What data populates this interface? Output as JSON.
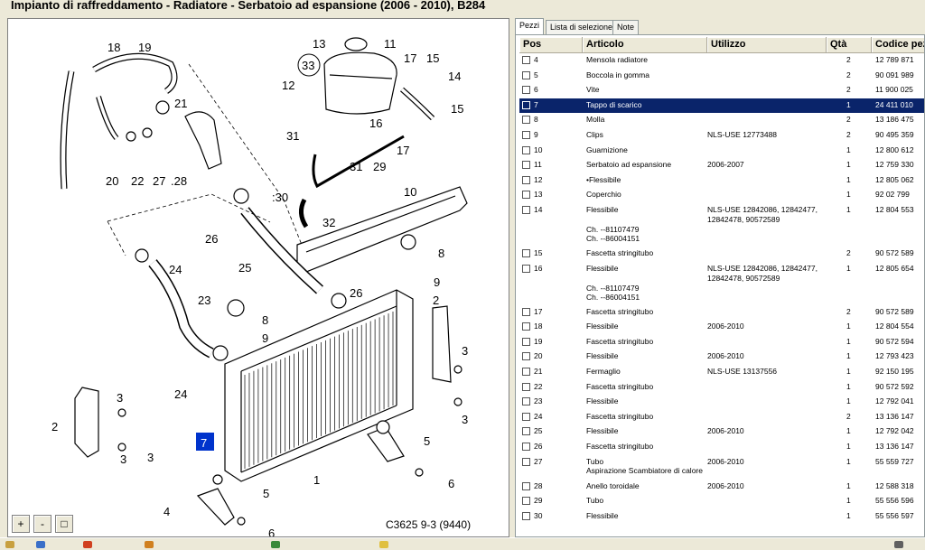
{
  "window": {
    "title": "Impianto di raffreddamento - Radiatore - Serbatoio ad espansione   (2006 - 2010), B284"
  },
  "diagram": {
    "figure_ref": "C3625 9-3 (9440)",
    "selected_callout": "7",
    "callouts": [
      "18",
      "19",
      "13",
      "11",
      "17",
      "15",
      "14",
      "15",
      "33",
      "12",
      "21",
      "16",
      "17",
      "31",
      "20",
      "22",
      "27",
      ".28",
      "31",
      "29",
      ":30",
      "10",
      "32",
      "26",
      "24",
      "25",
      "26",
      "8",
      "9",
      "23",
      "8",
      "9",
      "2",
      "3",
      "24",
      "3",
      "2",
      "3",
      "3",
      "5",
      "7",
      "5",
      "1",
      "4",
      "6",
      "6"
    ],
    "zoom": {
      "zoom_in": "+",
      "zoom_out": "-",
      "fit": "□"
    }
  },
  "tabs": [
    {
      "label": "Pezzi",
      "active": true
    },
    {
      "label": "Lista di selezione",
      "active": false
    },
    {
      "label": "Note",
      "active": false
    }
  ],
  "table": {
    "columns": [
      "Pos",
      "Articolo",
      "Utilizzo",
      "Qtà",
      "Codice pezzo"
    ],
    "selected_pos": "7",
    "rows": [
      {
        "pos": "4",
        "articolo": "Mensola radiatore",
        "utilizzo": "",
        "qta": "2",
        "codice": "12 789 871"
      },
      {
        "pos": "5",
        "articolo": "Boccola in gomma",
        "utilizzo": "",
        "qta": "2",
        "codice": "90 091 989"
      },
      {
        "pos": "6",
        "articolo": "Vite",
        "utilizzo": "",
        "qta": "2",
        "codice": "11 900 025"
      },
      {
        "pos": "7",
        "articolo": "Tappo di scarico",
        "utilizzo": "",
        "qta": "1",
        "codice": "24 411 010"
      },
      {
        "pos": "8",
        "articolo": "Molla",
        "utilizzo": "",
        "qta": "2",
        "codice": "13 186 475"
      },
      {
        "pos": "9",
        "articolo": "Clips",
        "utilizzo": "NLS-USE 12773488",
        "qta": "2",
        "codice": "90 495 359"
      },
      {
        "pos": "10",
        "articolo": "Guarnizione",
        "utilizzo": "",
        "qta": "1",
        "codice": "12 800 612"
      },
      {
        "pos": "11",
        "articolo": "Serbatoio ad espansione",
        "utilizzo": "2006-2007",
        "qta": "1",
        "codice": "12 759 330"
      },
      {
        "pos": "12",
        "articolo": "•Flessibile",
        "utilizzo": "",
        "qta": "1",
        "codice": "12 805 062"
      },
      {
        "pos": "13",
        "articolo": "Coperchio",
        "utilizzo": "",
        "qta": "1",
        "codice": "92 02 799"
      },
      {
        "pos": "14",
        "articolo": "Flessibile",
        "utilizzo": "NLS-USE 12842086, 12842477,",
        "utilizzo2": "12842478, 90572589",
        "extra1": "Ch. --81107479",
        "extra2": "Ch. --86004151",
        "qta": "1",
        "codice": "12 804 553"
      },
      {
        "pos": "15",
        "articolo": "Fascetta stringitubo",
        "utilizzo": "",
        "qta": "2",
        "codice": "90 572 589"
      },
      {
        "pos": "16",
        "articolo": "Flessibile",
        "utilizzo": "NLS-USE 12842086, 12842477,",
        "utilizzo2": "12842478, 90572589",
        "extra1": "Ch. --81107479",
        "extra2": "Ch. --86004151",
        "qta": "1",
        "codice": "12 805 654"
      },
      {
        "pos": "17",
        "articolo": "Fascetta stringitubo",
        "utilizzo": "",
        "qta": "2",
        "codice": "90 572 589"
      },
      {
        "pos": "18",
        "articolo": "Flessibile",
        "utilizzo": "2006-2010",
        "qta": "1",
        "codice": "12 804 554"
      },
      {
        "pos": "19",
        "articolo": "Fascetta stringitubo",
        "utilizzo": "",
        "qta": "1",
        "codice": "90 572 594"
      },
      {
        "pos": "20",
        "articolo": "Flessibile",
        "utilizzo": "2006-2010",
        "qta": "1",
        "codice": "12 793 423"
      },
      {
        "pos": "21",
        "articolo": "Fermaglio",
        "utilizzo": "NLS-USE 13137556",
        "qta": "1",
        "codice": "92 150 195"
      },
      {
        "pos": "22",
        "articolo": "Fascetta stringitubo",
        "utilizzo": "",
        "qta": "1",
        "codice": "90 572 592"
      },
      {
        "pos": "23",
        "articolo": "Flessibile",
        "utilizzo": "",
        "qta": "1",
        "codice": "12 792 041"
      },
      {
        "pos": "24",
        "articolo": "Fascetta stringitubo",
        "utilizzo": "",
        "qta": "2",
        "codice": "13 136 147"
      },
      {
        "pos": "25",
        "articolo": "Flessibile",
        "utilizzo": "2006-2010",
        "qta": "1",
        "codice": "12 792 042"
      },
      {
        "pos": "26",
        "articolo": "Fascetta stringitubo",
        "utilizzo": "",
        "qta": "1",
        "codice": "13 136 147"
      },
      {
        "pos": "27",
        "articolo": "Tubo",
        "articolo2": "Aspirazione  Scambiatore di calore",
        "utilizzo": "2006-2010",
        "qta": "1",
        "codice": "55 559 727"
      },
      {
        "pos": "28",
        "articolo": "Anello toroidale",
        "utilizzo": "2006-2010",
        "qta": "1",
        "codice": "12 588 318"
      },
      {
        "pos": "29",
        "articolo": "Tubo",
        "utilizzo": "",
        "qta": "1",
        "codice": "55 556 596"
      },
      {
        "pos": "30",
        "articolo": "Flessibile",
        "utilizzo": "",
        "qta": "1",
        "codice": "55 556 597"
      }
    ]
  },
  "colors": {
    "selection": "#0a246a",
    "window_bg": "#ece9d8",
    "callout_highlight": "#0033cc"
  }
}
